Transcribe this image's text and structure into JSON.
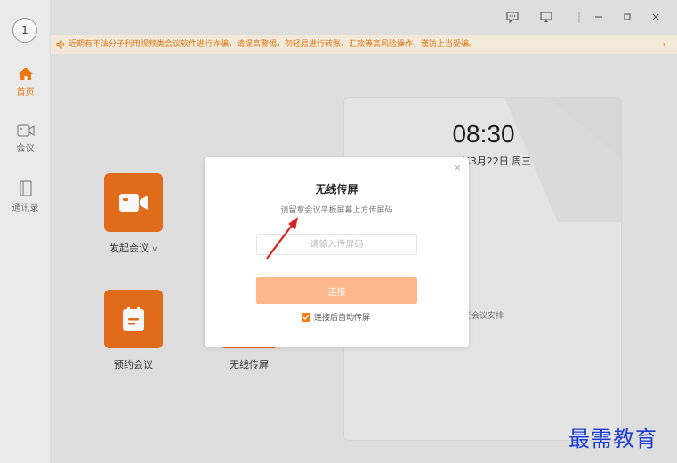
{
  "sidebar": {
    "avatar_text": "1",
    "items": [
      {
        "label": "首页",
        "icon": "home-icon"
      },
      {
        "label": "会议",
        "icon": "video-camera-icon"
      },
      {
        "label": "通讯录",
        "icon": "contacts-book-icon"
      }
    ]
  },
  "notice": {
    "text": "近期有不法分子利用视频类会议软件进行诈骗，请提高警惕，勿轻易进行转账、汇款等高风险操作，谨防上当受骗。",
    "chevron": "›"
  },
  "actions": [
    {
      "label": "发起会议",
      "chevron": "∨"
    },
    {
      "label": "预约会议"
    },
    {
      "label": "无线传屏"
    }
  ],
  "panel": {
    "time": "08:30",
    "date": "2022年3月22日 周三",
    "empty_text": "无会议安排"
  },
  "dialog": {
    "close": "×",
    "title": "无线传屏",
    "subtitle": "请留意会议平板屏幕上方传屏码",
    "input_placeholder": "请输入传屏码",
    "connect_label": "连接",
    "auto_label": "连接后自动传屏"
  },
  "watermark": "最需教育",
  "colors": {
    "accent": "#f07d16",
    "tile": "#e8701c",
    "connect_disabled": "#fdb78a",
    "watermark": "#1a3bd6"
  }
}
